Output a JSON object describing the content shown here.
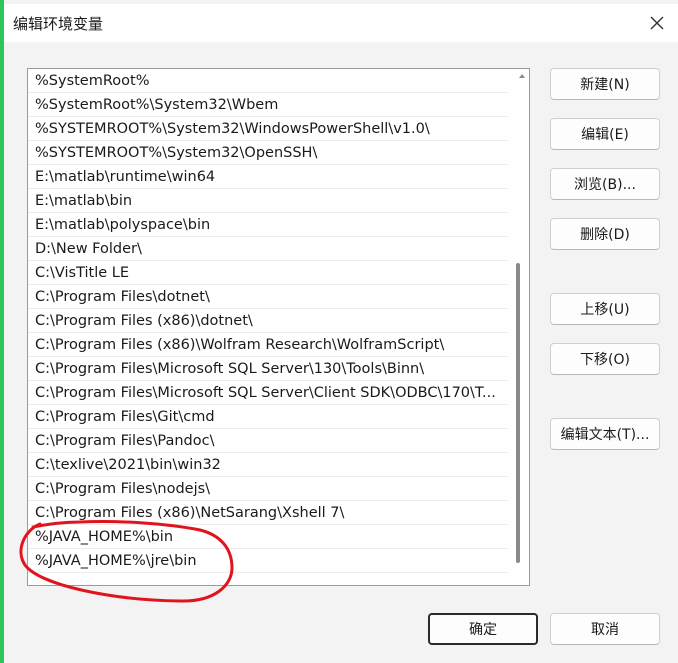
{
  "window": {
    "title": "编辑环境变量"
  },
  "icons": {
    "close": "close-icon",
    "scroll_up": "chevron-up-icon"
  },
  "list": {
    "items": [
      "%SystemRoot%",
      "%SystemRoot%\\System32\\Wbem",
      "%SYSTEMROOT%\\System32\\WindowsPowerShell\\v1.0\\",
      "%SYSTEMROOT%\\System32\\OpenSSH\\",
      "E:\\matlab\\runtime\\win64",
      "E:\\matlab\\bin",
      "E:\\matlab\\polyspace\\bin",
      "D:\\New Folder\\",
      "C:\\VisTitle LE",
      "C:\\Program Files\\dotnet\\",
      "C:\\Program Files (x86)\\dotnet\\",
      "C:\\Program Files (x86)\\Wolfram Research\\WolframScript\\",
      "C:\\Program Files\\Microsoft SQL Server\\130\\Tools\\Binn\\",
      "C:\\Program Files\\Microsoft SQL Server\\Client SDK\\ODBC\\170\\T...",
      "C:\\Program Files\\Git\\cmd",
      "C:\\Program Files\\Pandoc\\",
      "C:\\texlive\\2021\\bin\\win32",
      "C:\\Program Files\\nodejs\\",
      "C:\\Program Files (x86)\\NetSarang\\Xshell 7\\",
      "%JAVA_HOME%\\bin",
      "%JAVA_HOME%\\jre\\bin"
    ]
  },
  "buttons": {
    "new": "新建(N)",
    "edit": "编辑(E)",
    "browse": "浏览(B)...",
    "delete": "删除(D)",
    "move_up": "上移(U)",
    "move_down": "下移(O)",
    "edit_text": "编辑文本(T)...",
    "ok": "确定",
    "cancel": "取消"
  },
  "colors": {
    "window_edge": "#2fc55e",
    "annotation_stroke": "#e0141e"
  }
}
